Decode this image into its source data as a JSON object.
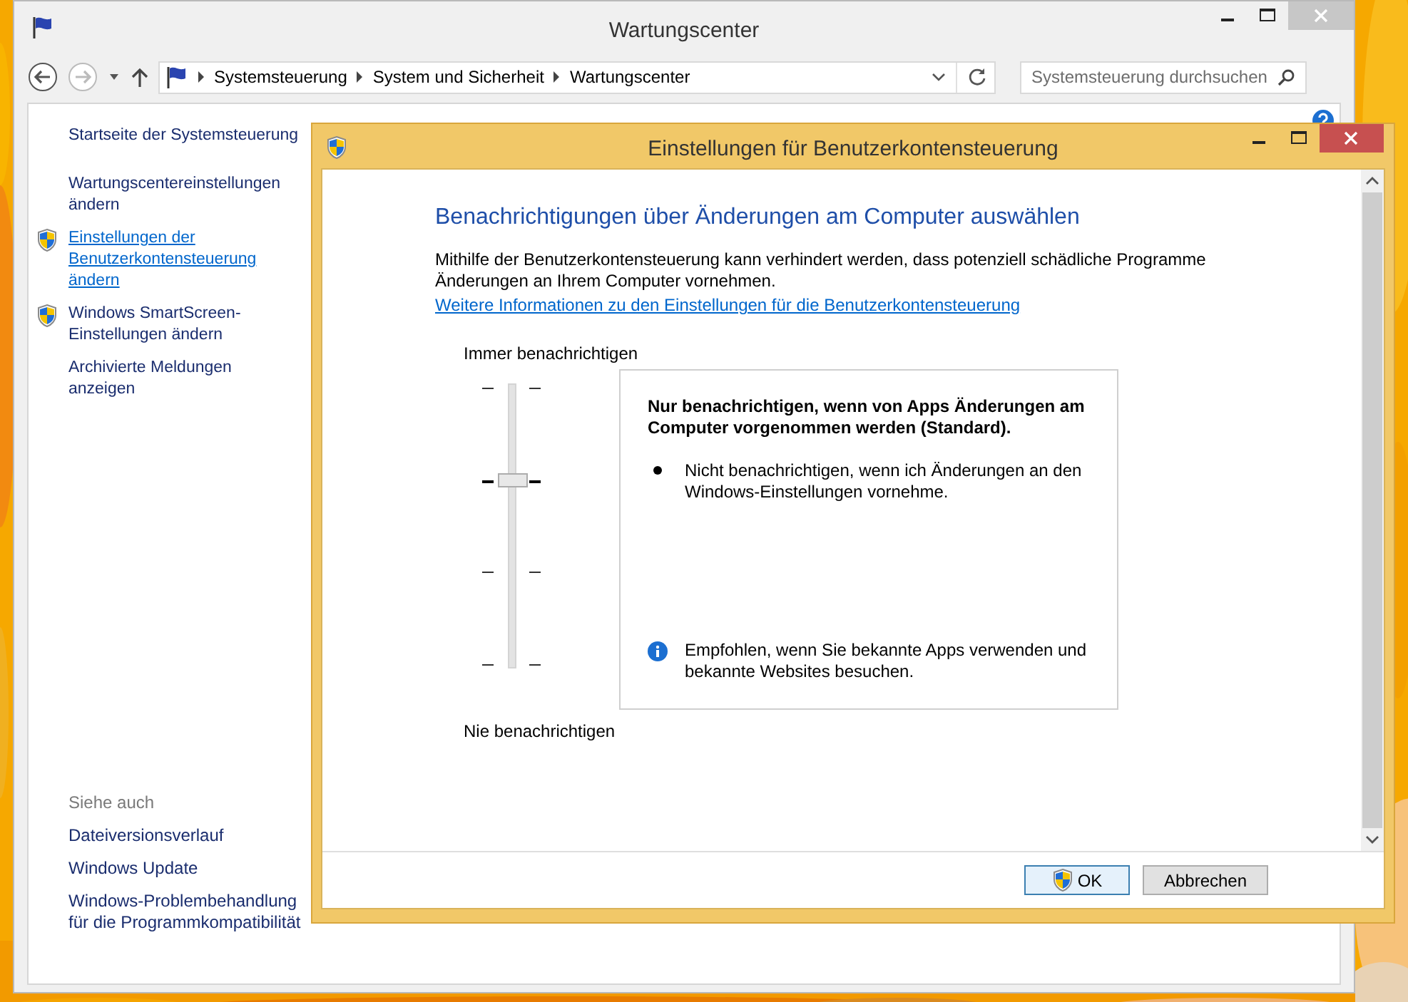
{
  "window": {
    "title": "Wartungscenter"
  },
  "address_bar": {
    "breadcrumb": [
      "Systemsteuerung",
      "System und Sicherheit",
      "Wartungscenter"
    ]
  },
  "search": {
    "placeholder": "Systemsteuerung durchsuchen"
  },
  "sidebar": {
    "items": [
      {
        "label": "Startseite der Systemsteuerung",
        "shield": false,
        "hovered": false
      },
      {
        "label": "Wartungscentereinstellungen ändern",
        "shield": false,
        "hovered": false
      },
      {
        "label": "Einstellungen der Benutzerkontensteuerung ändern",
        "shield": true,
        "hovered": true
      },
      {
        "label": "Windows SmartScreen-Einstellungen ändern",
        "shield": true,
        "hovered": false
      },
      {
        "label": "Archivierte Meldungen anzeigen",
        "shield": false,
        "hovered": false
      }
    ],
    "see_also": {
      "heading": "Siehe auch",
      "items": [
        "Dateiversionsverlauf",
        "Windows Update",
        "Windows-Problembehandlung für die Programmkompatibilität"
      ]
    }
  },
  "dialog": {
    "title": "Einstellungen für Benutzerkontensteuerung",
    "heading": "Benachrichtigungen über Änderungen am Computer auswählen",
    "description": "Mithilfe der Benutzerkontensteuerung kann verhindert werden, dass potenziell schädliche Programme Änderungen an Ihrem Computer vornehmen.",
    "link": "Weitere Informationen zu den Einstellungen für die Benutzerkontensteuerung",
    "slider": {
      "top_label": "Immer benachrichtigen",
      "bottom_label": "Nie benachrichtigen",
      "level": 0.667
    },
    "info_box": {
      "title": "Nur benachrichtigen, wenn von Apps Änderungen am Computer vorgenommen werden (Standard).",
      "bullets": [
        "Nicht benachrichtigen, wenn ich Änderungen an den Windows-Einstellungen vornehme."
      ],
      "note": "Empfohlen, wenn Sie bekannte Apps verwenden und bekannte Websites besuchen."
    },
    "buttons": [
      {
        "label": "OK",
        "kind": "default",
        "shield": true
      },
      {
        "label": "Abbrechen",
        "kind": "normal",
        "shield": false
      }
    ]
  }
}
